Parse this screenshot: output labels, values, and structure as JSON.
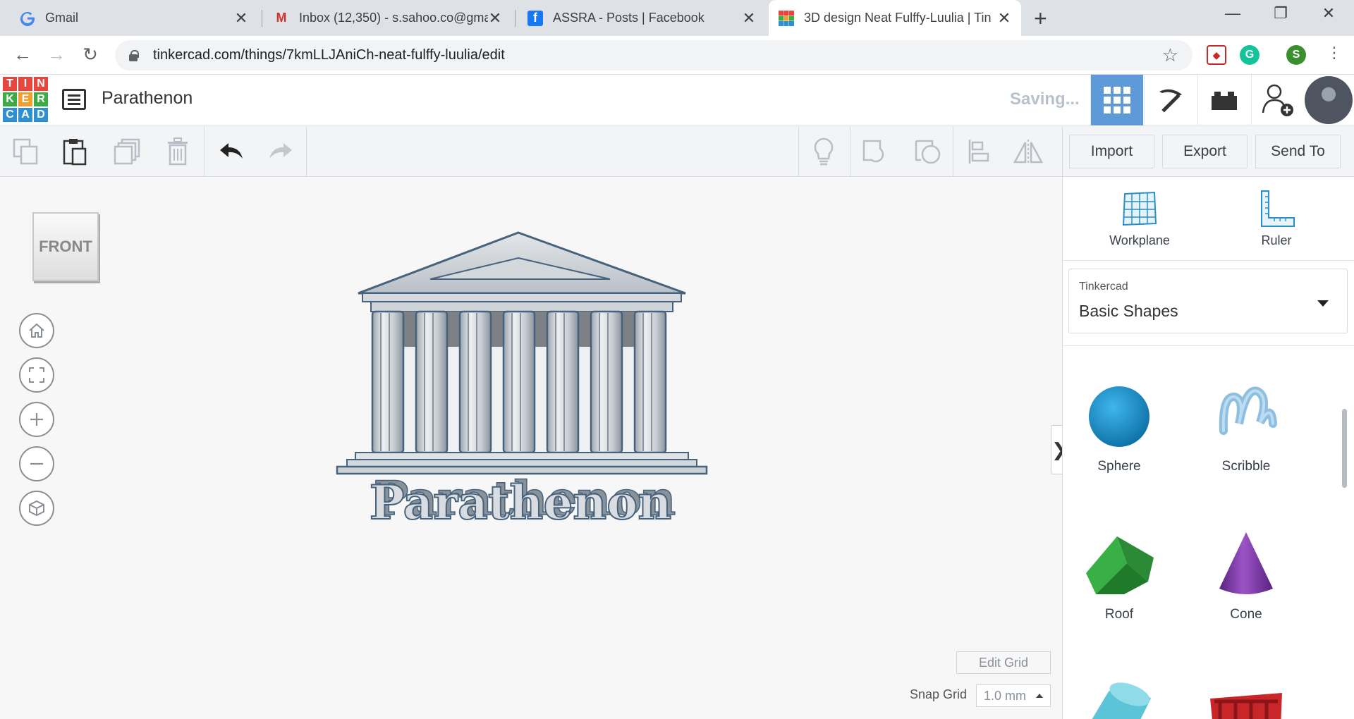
{
  "browser": {
    "tabs": [
      {
        "title": "Gmail",
        "icon": "google-icon"
      },
      {
        "title": "Inbox (12,350) - s.sahoo.co@gma",
        "icon": "gmail-icon"
      },
      {
        "title": "ASSRA - Posts | Facebook",
        "icon": "facebook-icon"
      },
      {
        "title": "3D design Neat Fulffy-Luulia | Tin",
        "icon": "tinkercad-icon",
        "active": true
      }
    ],
    "url": "tinkercad.com/things/7kmLLJAniCh-neat-fulffy-luulia/edit",
    "profile_initial": "S"
  },
  "header": {
    "logo_letters": [
      "T",
      "I",
      "N",
      "K",
      "E",
      "R",
      "C",
      "A",
      "D"
    ],
    "logo_colors": [
      "#e8453c",
      "#e8453c",
      "#e8453c",
      "#3cab45",
      "#f2a02d",
      "#3cab45",
      "#2f8fd0",
      "#2f8fd0",
      "#2f8fd0"
    ],
    "design_name": "Parathenon",
    "status": "Saving..."
  },
  "toolbar": {
    "import_label": "Import",
    "export_label": "Export",
    "sendto_label": "Send To"
  },
  "workspace": {
    "viewcube_label": "FRONT",
    "model_text": "Parathenon",
    "edit_grid_label": "Edit Grid",
    "snap_grid_label": "Snap Grid",
    "snap_grid_value": "1.0 mm"
  },
  "panel": {
    "tools": [
      {
        "label": "Workplane"
      },
      {
        "label": "Ruler"
      }
    ],
    "library_source": "Tinkercad",
    "library_name": "Basic Shapes",
    "shapes": [
      {
        "label": "Sphere",
        "color": "#1a8fc9"
      },
      {
        "label": "Scribble",
        "color": "#8fbfe0"
      },
      {
        "label": "Roof",
        "color": "#2e9a3a"
      },
      {
        "label": "Cone",
        "color": "#7b3aa0"
      }
    ]
  },
  "colors": {
    "accent": "#5d9ad7",
    "tab_strip": "#dee1e6",
    "workspace_bg": "#f7f7f7"
  }
}
